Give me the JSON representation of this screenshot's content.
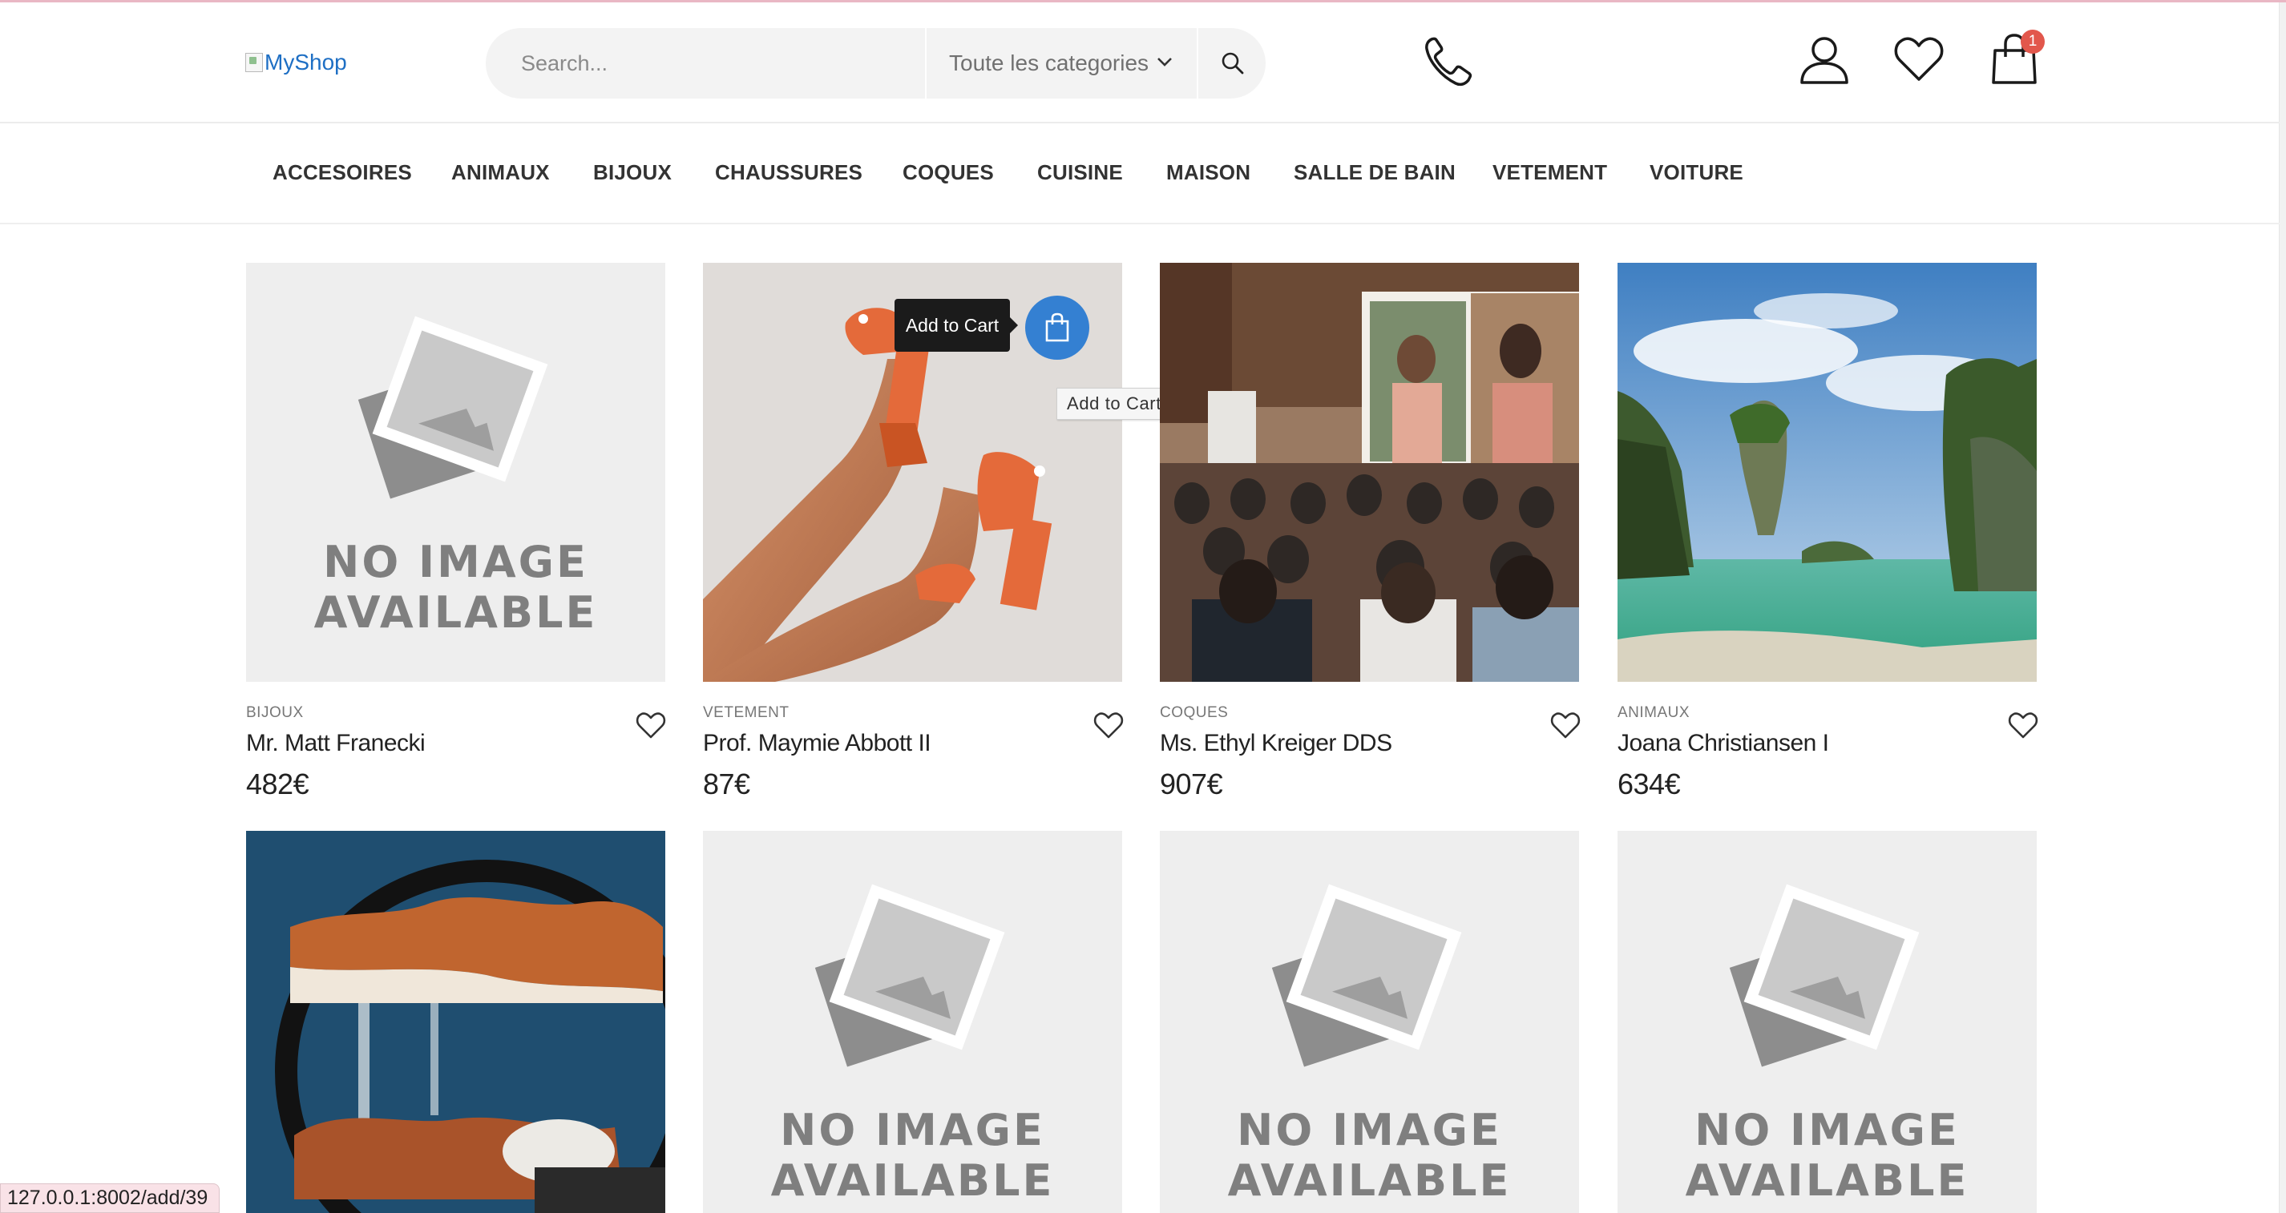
{
  "header": {
    "logo_alt": "MyShop",
    "search_placeholder": "Search...",
    "category_select": "Toute les categories",
    "cart_count": "1"
  },
  "nav": {
    "items": [
      "ACCESOIRES",
      "ANIMAUX",
      "BIJOUX",
      "CHAUSSURES",
      "COQUES",
      "CUISINE",
      "MAISON",
      "SALLE DE BAIN",
      "VETEMENT",
      "VOITURE"
    ]
  },
  "products": [
    {
      "category": "BIJOUX",
      "name": "Mr. Matt Franecki",
      "price": "482€",
      "image": "no-image-placeholder"
    },
    {
      "category": "VETEMENT",
      "name": "Prof. Maymie Abbott II",
      "price": "87€",
      "image": "orange-platform-sandals-photo"
    },
    {
      "category": "COQUES",
      "name": "Ms. Ethyl Kreiger DDS",
      "price": "907€",
      "image": "conference-audience-photo"
    },
    {
      "category": "ANIMAUX",
      "name": "Joana Christiansen I",
      "price": "634€",
      "image": "tropical-karst-island-photo"
    },
    {
      "image": "sand-art-frame-photo"
    },
    {
      "image": "no-image-placeholder"
    },
    {
      "image": "no-image-placeholder"
    },
    {
      "image": "no-image-placeholder"
    }
  ],
  "placeholder": {
    "line1": "NO IMAGE",
    "line2": "AVAILABLE"
  },
  "hover": {
    "tooltip": "Add to Cart",
    "browser_tooltip": "Add to Cart"
  },
  "status_bar": {
    "url": "127.0.0.1:8002/add/39"
  },
  "colors": {
    "accent": "#3480d2",
    "badge": "#e2574c",
    "status_bg": "#f9e2e7"
  }
}
